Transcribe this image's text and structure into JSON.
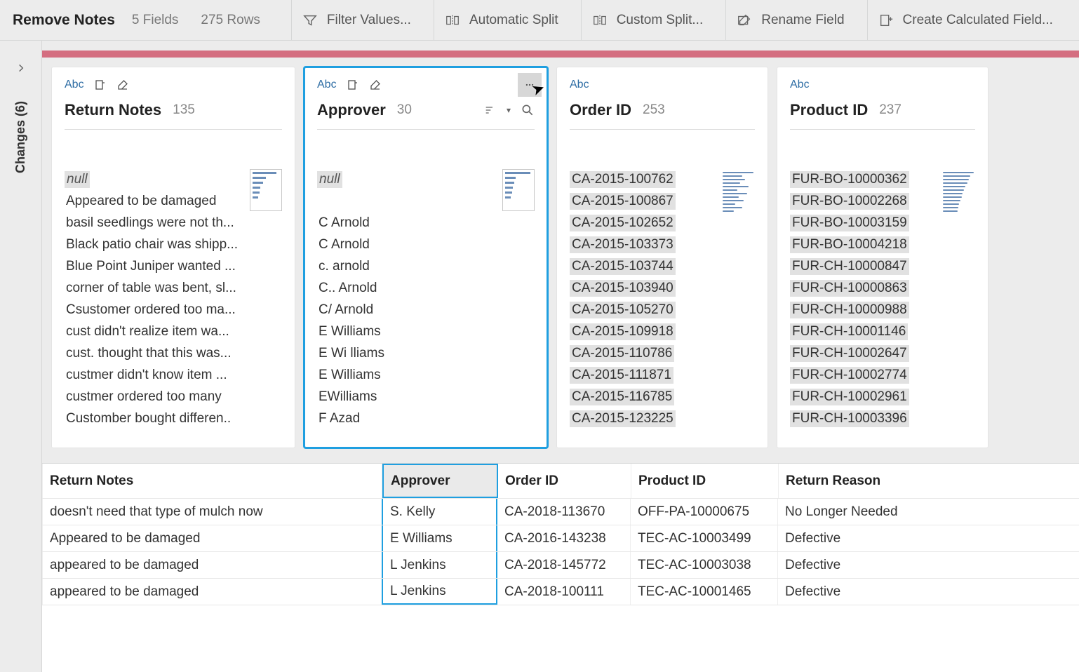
{
  "header": {
    "title": "Remove Notes",
    "fields_label": "5 Fields",
    "rows_label": "275 Rows",
    "buttons": {
      "filter": "Filter Values...",
      "autosplit": "Automatic Split",
      "customsplit": "Custom Split...",
      "rename": "Rename Field",
      "calcfield": "Create Calculated Field..."
    }
  },
  "sidebar": {
    "changes_label": "Changes (6)"
  },
  "cards": [
    {
      "type_label": "Abc",
      "title": "Return Notes",
      "count": "135",
      "values": [
        "null",
        "Appeared to be damaged",
        "basil seedlings were not th...",
        "Black patio chair was shipp...",
        "Blue Point Juniper wanted ...",
        "corner of table was bent, sl...",
        "Csustomer ordered too ma...",
        "cust didn't realize item wa...",
        "cust. thought that this was...",
        "custmer didn't know item ...",
        "custmer ordered too many",
        "Customber bought differen.."
      ],
      "null_index": 0
    },
    {
      "type_label": "Abc",
      "title": "Approver",
      "count": "30",
      "values": [
        "null",
        "",
        "C  Arnold",
        "C Arnold",
        "c. arnold",
        "C.. Arnold",
        "C/ Arnold",
        "E   Williams",
        "E Wi lliams",
        "E Williams",
        "EWilliams",
        "F Azad"
      ],
      "null_index": 0
    },
    {
      "type_label": "Abc",
      "title": "Order ID",
      "count": "253",
      "values": [
        "CA-2015-100762",
        "CA-2015-100867",
        "CA-2015-102652",
        "CA-2015-103373",
        "CA-2015-103744",
        "CA-2015-103940",
        "CA-2015-105270",
        "CA-2015-109918",
        "CA-2015-110786",
        "CA-2015-111871",
        "CA-2015-116785",
        "CA-2015-123225"
      ]
    },
    {
      "type_label": "Abc",
      "title": "Product ID",
      "count": "237",
      "values": [
        "FUR-BO-10000362",
        "FUR-BO-10002268",
        "FUR-BO-10003159",
        "FUR-BO-10004218",
        "FUR-CH-10000847",
        "FUR-CH-10000863",
        "FUR-CH-10000988",
        "FUR-CH-10001146",
        "FUR-CH-10002647",
        "FUR-CH-10002774",
        "FUR-CH-10002961",
        "FUR-CH-10003396"
      ]
    }
  ],
  "grid": {
    "columns": [
      "Return Notes",
      "Approver",
      "Order ID",
      "Product ID",
      "Return Reason"
    ],
    "rows": [
      [
        "doesn't need that type of mulch now",
        "S. Kelly",
        "CA-2018-113670",
        "OFF-PA-10000675",
        "No Longer Needed"
      ],
      [
        "Appeared to be damaged",
        "E Williams",
        "CA-2016-143238",
        "TEC-AC-10003499",
        "Defective"
      ],
      [
        "appeared to be damaged",
        "L Jenkins",
        "CA-2018-145772",
        "TEC-AC-10003038",
        "Defective"
      ],
      [
        "appeared to be damaged",
        "L Jenkins",
        "CA-2018-100111",
        "TEC-AC-10001465",
        "Defective"
      ]
    ]
  }
}
